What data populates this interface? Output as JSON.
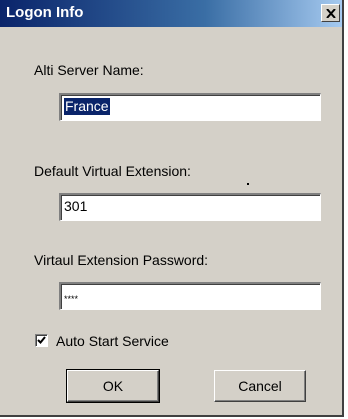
{
  "window": {
    "title": "Logon Info",
    "close_glyph": "×"
  },
  "fields": [
    {
      "label": "Alti Server Name:",
      "value": "France"
    },
    {
      "label": "Default Virtual Extension:",
      "value": "301"
    },
    {
      "label": "Virtaul Extension Password:",
      "value": "****"
    }
  ],
  "checkbox": {
    "label": "Auto Start Service",
    "checked": true
  },
  "buttons": {
    "ok": "OK",
    "cancel": "Cancel"
  },
  "colors": {
    "dialog_bg": "#d4d0c8",
    "titlebar_start": "#0a246a",
    "titlebar_end": "#a6caf0",
    "selection": "#0a246a"
  }
}
